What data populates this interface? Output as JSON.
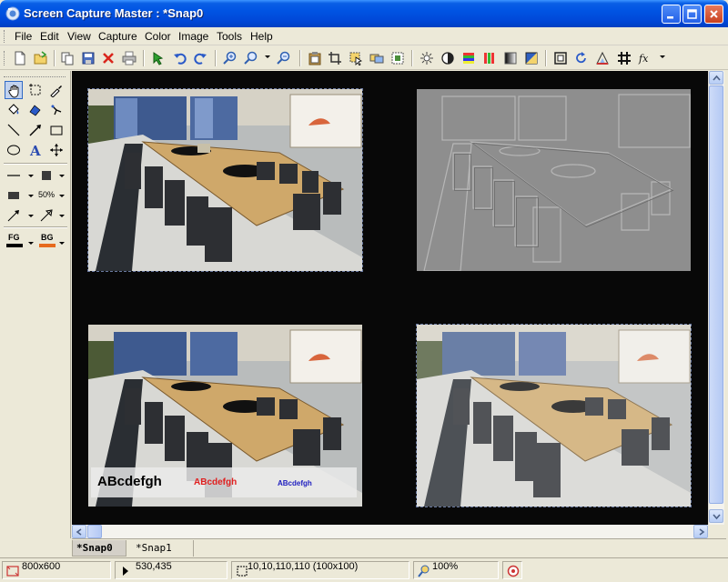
{
  "window": {
    "title": "Screen Capture Master : *Snap0"
  },
  "menu": [
    "File",
    "Edit",
    "View",
    "Capture",
    "Color",
    "Image",
    "Tools",
    "Help"
  ],
  "toolbar_icons": [
    "new-icon",
    "open-icon",
    "copy-icon",
    "save-icon",
    "delete-icon",
    "print-icon",
    "capture-icon",
    "undo-icon",
    "redo-icon",
    "zoom-in-icon",
    "zoom-dropdown-icon",
    "zoom-out-icon",
    "paste-icon",
    "crop-icon",
    "select-icon",
    "layers-icon",
    "effects-icon",
    "brightness-icon",
    "contrast-icon",
    "color-balance-icon",
    "levels-icon",
    "gradient-icon",
    "invert-icon",
    "frame-icon",
    "rotate-icon",
    "perspective-icon",
    "sharpen-icon",
    "function-icon"
  ],
  "tools": {
    "opacity_label": "50%",
    "fg_label": "FG",
    "bg_label": "BG",
    "fg_color": "#000000",
    "bg_color": "#e66a1e"
  },
  "snaps": {
    "overlay_text_large": "ABcdefgh",
    "overlay_text_medium": "ABcdefgh",
    "overlay_text_small": "ABcdefgh",
    "overlay_colors": {
      "large": "#000000",
      "medium": "#e02020",
      "small": "#2020c0"
    }
  },
  "tabs": [
    {
      "label": "*Snap0",
      "active": true
    },
    {
      "label": "*Snap1",
      "active": false
    }
  ],
  "status": {
    "image_size": "800x600",
    "cursor_pos": "530,435",
    "selection": "10,10,110,110 (100x100)",
    "zoom": "100%"
  }
}
